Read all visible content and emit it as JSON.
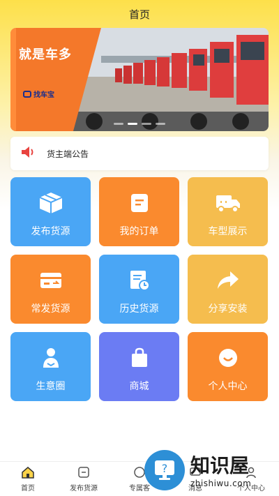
{
  "header": {
    "title": "首页"
  },
  "banner": {
    "title": "就是车多",
    "logo_text": "找车宝",
    "active_slide": 1,
    "slides": 4
  },
  "notice": {
    "text": "货主端公告"
  },
  "tiles": [
    {
      "label": "发布货源",
      "color": "#4aa6f5",
      "icon": "box-icon"
    },
    {
      "label": "我的订单",
      "color": "#fa8a2e",
      "icon": "order-icon"
    },
    {
      "label": "车型展示",
      "color": "#f5bd4e",
      "icon": "truck-icon"
    },
    {
      "label": "常发货源",
      "color": "#fa8a2e",
      "icon": "card-icon"
    },
    {
      "label": "历史货源",
      "color": "#4aa6f5",
      "icon": "history-icon"
    },
    {
      "label": "分享安装",
      "color": "#f5bd4e",
      "icon": "share-icon"
    },
    {
      "label": "生意圈",
      "color": "#4aa6f5",
      "icon": "people-icon"
    },
    {
      "label": "商城",
      "color": "#6b7cf3",
      "icon": "shopping-bag-icon"
    },
    {
      "label": "个人中心",
      "color": "#fa8a2e",
      "icon": "smile-icon"
    }
  ],
  "tabbar": [
    {
      "label": "首页",
      "icon": "home-icon",
      "active": true
    },
    {
      "label": "发布货源",
      "icon": "publish-icon"
    },
    {
      "label": "专属客",
      "icon": "service-icon"
    },
    {
      "label": "消息",
      "icon": "message-icon"
    },
    {
      "label": "个人中心",
      "icon": "user-icon"
    }
  ],
  "watermark": {
    "title": "知识屋",
    "domain": "zhishiwu.com"
  }
}
